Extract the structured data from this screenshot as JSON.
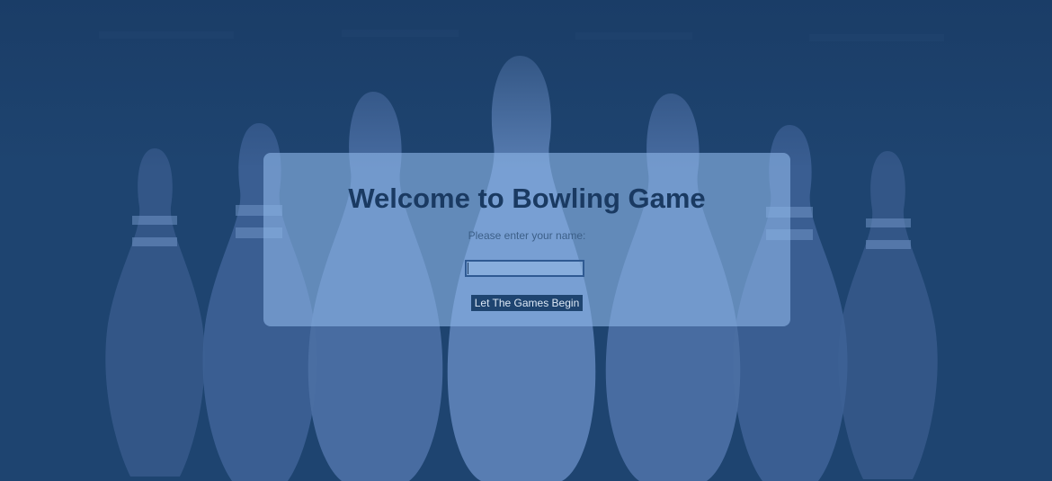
{
  "welcome": {
    "title": "Welcome to Bowling Game",
    "prompt": "Please enter your name:",
    "name_value": "",
    "start_button_label": "Let The Games Begin"
  },
  "colors": {
    "background": "#1e4470",
    "pin": "#4f73a6",
    "dialog": "#8cb4e6",
    "title_text": "#1a3a62",
    "button": "#1e4470"
  },
  "icons": {
    "background_image": "bowling-pins-image"
  }
}
